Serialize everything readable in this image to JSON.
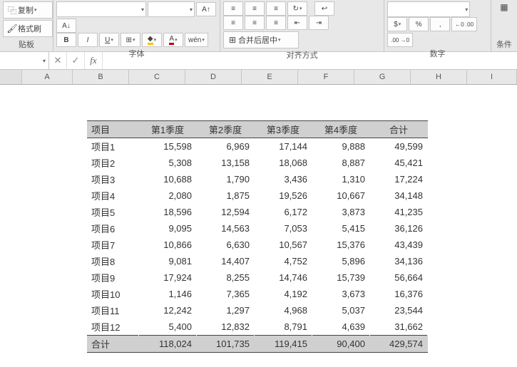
{
  "ribbon": {
    "clipboard": {
      "copy": "复制",
      "format_painter": "格式刷",
      "label": "贴板"
    },
    "font": {
      "bold": "B",
      "italic": "I",
      "underline": "U",
      "border": "⊞",
      "fill": "▦",
      "font_color": "A",
      "phonetic": "wén",
      "label": "字体"
    },
    "align": {
      "merge": "合并后居中",
      "label": "对齐方式"
    },
    "number": {
      "percent": "%",
      "comma": ",",
      "inc": "←0 .00",
      "dec": ".00 →0",
      "label": "数字"
    },
    "cond": "条件"
  },
  "namebox": "",
  "cols": [
    "A",
    "B",
    "C",
    "D",
    "E",
    "F",
    "G",
    "H",
    "I"
  ],
  "chart_data": {
    "type": "table",
    "title": "",
    "headers": [
      "项目",
      "第1季度",
      "第2季度",
      "第3季度",
      "第4季度",
      "合计"
    ],
    "rows": [
      {
        "name": "项目1",
        "q": [
          15598,
          6969,
          17144,
          9888
        ],
        "total": 49599
      },
      {
        "name": "项目2",
        "q": [
          5308,
          13158,
          18068,
          8887
        ],
        "total": 45421
      },
      {
        "name": "项目3",
        "q": [
          10688,
          1790,
          3436,
          1310
        ],
        "total": 17224
      },
      {
        "name": "项目4",
        "q": [
          2080,
          1875,
          19526,
          10667
        ],
        "total": 34148
      },
      {
        "name": "项目5",
        "q": [
          18596,
          12594,
          6172,
          3873
        ],
        "total": 41235
      },
      {
        "name": "项目6",
        "q": [
          9095,
          14563,
          7053,
          5415
        ],
        "total": 36126
      },
      {
        "name": "项目7",
        "q": [
          10866,
          6630,
          10567,
          15376
        ],
        "total": 43439
      },
      {
        "name": "项目8",
        "q": [
          9081,
          14407,
          4752,
          5896
        ],
        "total": 34136
      },
      {
        "name": "项目9",
        "q": [
          17924,
          8255,
          14746,
          15739
        ],
        "total": 56664
      },
      {
        "name": "项目10",
        "q": [
          1146,
          7365,
          4192,
          3673
        ],
        "total": 16376
      },
      {
        "name": "项目11",
        "q": [
          12242,
          1297,
          4968,
          5037
        ],
        "total": 23544
      },
      {
        "name": "项目12",
        "q": [
          5400,
          12832,
          8791,
          4639
        ],
        "total": 31662
      }
    ],
    "totals": {
      "name": "合计",
      "q": [
        118024,
        101735,
        119415,
        90400
      ],
      "total": 429574
    }
  }
}
